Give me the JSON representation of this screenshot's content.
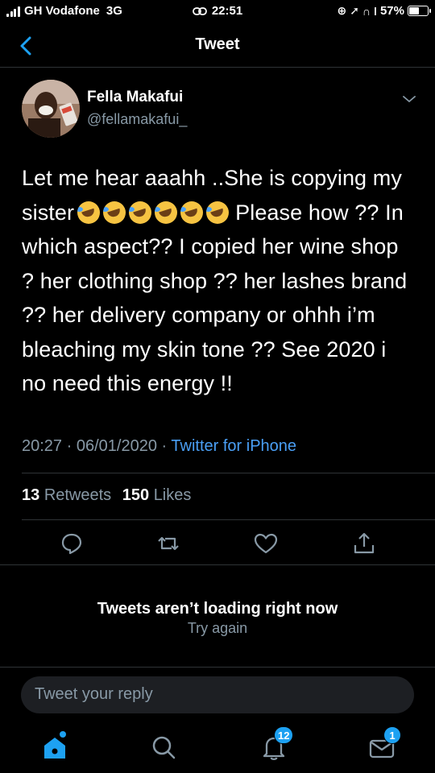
{
  "status_bar": {
    "carrier": "GH Vodafone",
    "network": "3G",
    "time": "22:51",
    "battery": "57%",
    "battery_level": 0.57
  },
  "nav": {
    "title": "Tweet"
  },
  "tweet": {
    "author_name": "Fella Makafui",
    "author_handle": "@fellamakafui_",
    "text_before_emoji": "Let me hear aaahh ..She is copying my sister",
    "emoji_count": 6,
    "text_after_emoji": "Please how ?? In which aspect?? I copied her wine shop ? her clothing shop ?? her lashes brand ?? her delivery company or ohhh i’m bleaching my skin tone ?? See 2020 i no need this energy !!",
    "time": "20:27",
    "date": "06/01/2020",
    "separator": "·",
    "source": "Twitter for iPhone",
    "retweets_count": "13",
    "retweets_label": "Retweets",
    "likes_count": "150",
    "likes_label": "Likes"
  },
  "error": {
    "title": "Tweets aren’t loading right now",
    "retry": "Try again"
  },
  "reply": {
    "placeholder": "Tweet your reply"
  },
  "tabs": {
    "notifications_badge": "12",
    "messages_badge": "1"
  },
  "colors": {
    "background": "#000000",
    "accent": "#1da1f2",
    "link": "#4a9ff5",
    "secondary_text": "#8899a6",
    "divider": "#2f3336"
  }
}
